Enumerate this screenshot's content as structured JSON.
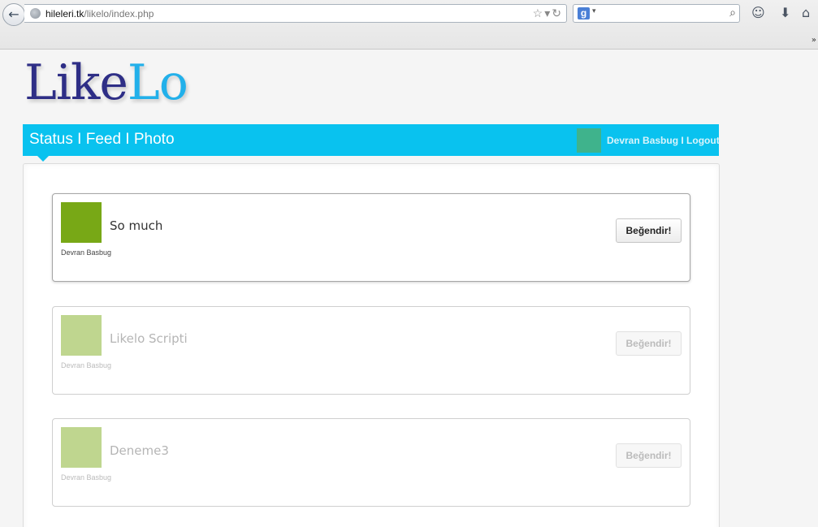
{
  "browser": {
    "url_host": "hileleri.tk",
    "url_path": "/likelo/index.php",
    "search_provider_letter": "g"
  },
  "logo": {
    "part_a": "Like",
    "part_b": "Lo"
  },
  "nav": {
    "links": [
      "Status",
      "Feed",
      "Photo"
    ],
    "separator": " I ",
    "user_name": "Devran Basbug",
    "user_separator": " I ",
    "logout": "Logout"
  },
  "posts": [
    {
      "title": "So much",
      "author": "Devran Basbug",
      "like_label": "Beğendir!",
      "state": "active"
    },
    {
      "title": "Likelo Scripti",
      "author": "Devran Basbug",
      "like_label": "Beğendir!",
      "state": "dim"
    },
    {
      "title": "Deneme3",
      "author": "Devran Basbug",
      "like_label": "Beğendir!",
      "state": "dim"
    }
  ],
  "colors": {
    "navbar": "#09c2ef",
    "logo_dark": "#2e2e86",
    "logo_light": "#22b0ea",
    "avatar_green": "#78a816",
    "user_avatar": "#3fb38c"
  }
}
